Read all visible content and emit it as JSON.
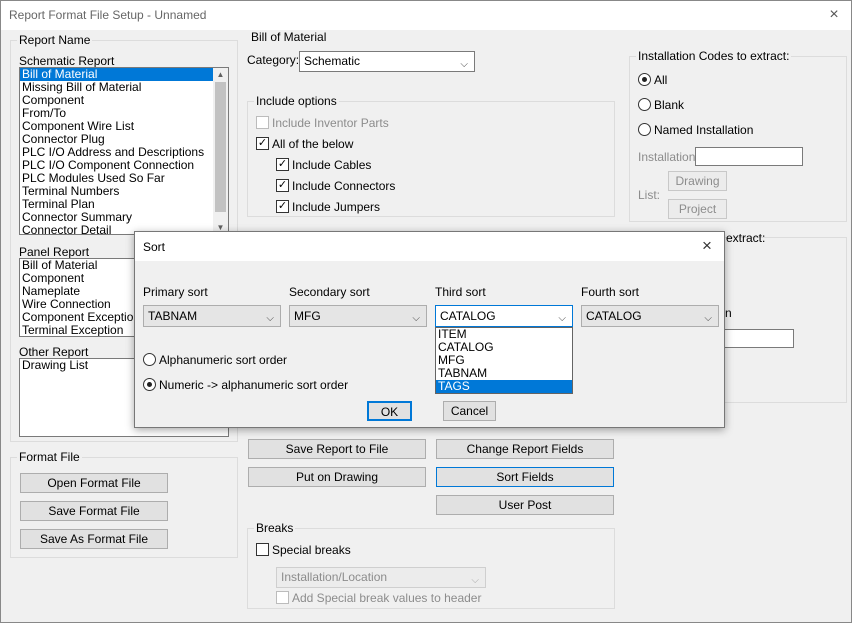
{
  "window": {
    "title": "Report Format File Setup - Unnamed",
    "close_icon": "×"
  },
  "report_name": {
    "label": "Report Name",
    "schematic_label": "Schematic Report",
    "schematic_items": [
      "Bill of Material",
      "Missing Bill of Material",
      "Component",
      "From/To",
      "Component Wire List",
      "Connector Plug",
      "PLC I/O Address and Descriptions",
      "PLC I/O Component Connection",
      "PLC Modules Used So Far",
      "Terminal Numbers",
      "Terminal Plan",
      "Connector Summary",
      "Connector Detail"
    ],
    "panel_label": "Panel Report",
    "panel_items": [
      "Bill of Material",
      "Component",
      "Nameplate",
      "Wire Connection",
      "Component Exception",
      "Terminal Exception"
    ],
    "other_label": "Other Report",
    "other_items": [
      "Drawing List"
    ]
  },
  "format_file": {
    "label": "Format File",
    "open": "Open Format File",
    "save": "Save Format File",
    "save_as": "Save As Format File"
  },
  "bom": {
    "label": "Bill of Material",
    "category_label": "Category:",
    "category_value": "Schematic",
    "include_label": "Include options",
    "include_inventor": "Include Inventor Parts",
    "all_below": "All of the below",
    "include_cables": "Include Cables",
    "include_connectors": "Include Connectors",
    "include_jumpers": "Include Jumpers"
  },
  "install": {
    "label": "Installation Codes to extract:",
    "all": "All",
    "blank": "Blank",
    "named": "Named Installation",
    "installation_label": "Installation",
    "list_label": "List:",
    "drawing": "Drawing",
    "project": "Project"
  },
  "location": {
    "label_frag": "extract:",
    "n_frag": "n"
  },
  "buttons": {
    "save_report": "Save Report to File",
    "change_fields": "Change Report Fields",
    "put_on_drawing": "Put on Drawing",
    "sort_fields": "Sort Fields",
    "user_post": "User Post"
  },
  "breaks": {
    "label": "Breaks",
    "special": "Special breaks",
    "combo_value": "Installation/Location",
    "add_values": "Add Special break values to header"
  },
  "sort_dialog": {
    "title": "Sort",
    "close_icon": "×",
    "primary_label": "Primary sort",
    "primary_value": "TABNAM",
    "secondary_label": "Secondary sort",
    "secondary_value": "MFG",
    "third_label": "Third sort",
    "third_value": "CATALOG",
    "fourth_label": "Fourth sort",
    "fourth_value": "CATALOG",
    "third_options": [
      "ITEM",
      "CATALOG",
      "MFG",
      "TABNAM",
      "TAGS"
    ],
    "alpha_label": "Alphanumeric sort order",
    "numeric_label": "Numeric -> alphanumeric sort order",
    "ok": "OK",
    "cancel": "Cancel"
  },
  "icons": {
    "chevron": "⌵",
    "check": "✓"
  }
}
